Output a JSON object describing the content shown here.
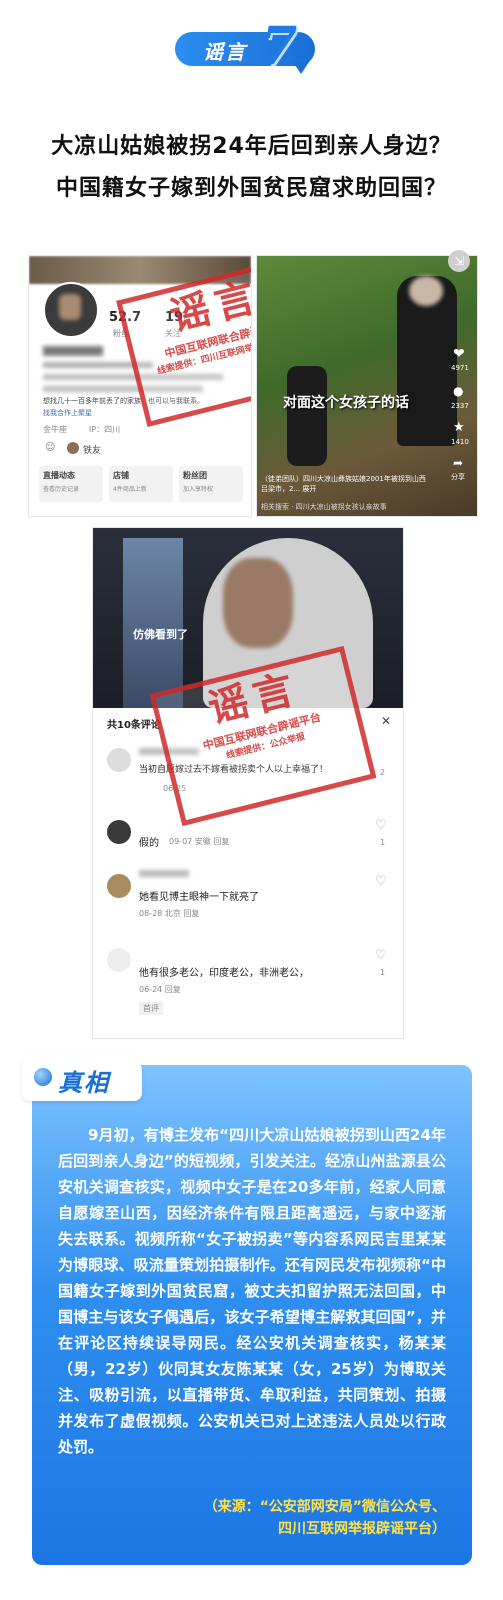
{
  "header": {
    "badge_label": "谣言",
    "badge_number": "7"
  },
  "headline": {
    "line1": "大凉山姑娘被拐24年后回到亲人身边？",
    "line2": "中国籍女子嫁到外国贫民窟求助回国？"
  },
  "stamp": {
    "big": "谣言",
    "line1": "中国互联网联合辟谣平台",
    "line2": "线索提供：四川互联网举报辟谣平台",
    "line2_short": "线索提供：公众举报"
  },
  "panel1": {
    "stat1": "52.7",
    "stat1_label": "粉丝",
    "stat2": "19",
    "stat2_label": "关注",
    "bio": "想找几十一百多年前丢了的家族，也可以与我联系。",
    "bio_link": "找我合作上聚星",
    "tag1": "金牛座",
    "tag2": "IP：四川",
    "friend": "铁友",
    "tab1": "直播动态",
    "tab1_sub": "查看历史记录",
    "tab2": "店铺",
    "tab2_sub": "4件商品上新",
    "tab3": "粉丝团",
    "tab3_sub": "加入享特权"
  },
  "panel2": {
    "caption": "对面这个女孩子的话",
    "desc": "（徒弟团队）四川大凉山彝族姑娘2001年被拐到山西吕梁市，2... 展开",
    "search": "相关搜索 · 四川大凉山被拐女孩认亲故事",
    "likes": "4971",
    "comments": "2337",
    "stars": "1410",
    "share": "分享"
  },
  "panel3": {
    "video_caption": "仿佛看到了",
    "comment_count": "共10条评论",
    "comments": [
      {
        "text": "当初自愿嫁过去不嫁看被拐卖个人以上幸福了！",
        "meta": "06-25",
        "likes": "2"
      },
      {
        "text": "假的",
        "meta": "09-07 安徽 回复",
        "likes": "1"
      },
      {
        "text": "她看见博主眼神一下就亮了",
        "meta": "08-28 北京 回复",
        "likes": ""
      },
      {
        "text": "他有很多老公，印度老公，非洲老公，",
        "meta": "06-24 回复",
        "likes": "1"
      }
    ],
    "author_tag": "首评"
  },
  "truth": {
    "tab_label": "真相",
    "body": "9月初，有博主发布“四川大凉山姑娘被拐到山西24年后回到亲人身边”的短视频，引发关注。经凉山州盐源县公安机关调查核实，视频中女子是在20多年前，经家人同意自愿嫁至山西，因经济条件有限且距离遥远，与家中逐渐失去联系。视频所称“女子被拐卖”等内容系网民吉里某某为博眼球、吸流量策划拍摄制作。还有网民发布视频称“中国籍女子嫁到外国贫民窟，被丈夫扣留护照无法回国，中国博主与该女子偶遇后，该女子希望博主解救其回国”，并在评论区持续误导网民。经公安机关调查核实，杨某某（男，22岁）伙同其女友陈某某（女，25岁）为博取关注、吸粉引流，以直播带货、牟取利益，共同策划、拍摄并发布了虚假视频。公安机关已对上述违法人员处以行政处罚。",
    "source_line1": "（来源：“公安部网安局”微信公众号、",
    "source_line2": "四川互联网举报辟谣平台）"
  },
  "colors": {
    "brand_blue": "#1a6fd6",
    "stamp_red": "#d22a2a",
    "source_yellow": "#ffe24a"
  }
}
